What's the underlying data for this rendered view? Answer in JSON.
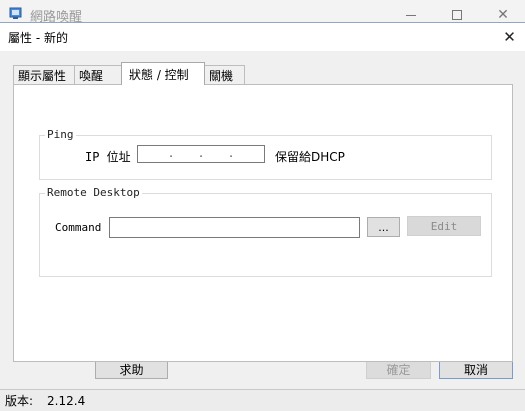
{
  "background_window": {
    "title": "網路喚醒"
  },
  "dialog": {
    "title": "屬性 - 新的",
    "close_glyph": "✕"
  },
  "tabs": [
    {
      "label": "顯示屬性",
      "active": false
    },
    {
      "label": "喚醒",
      "active": false
    },
    {
      "label": "狀態 / 控制",
      "active": true
    },
    {
      "label": "關機",
      "active": false
    }
  ],
  "ping_group": {
    "legend": "Ping",
    "ip_label": "IP 位址",
    "ip_separators": [
      ".",
      ".",
      "."
    ],
    "ip_value": "",
    "dhcp_label": "保留給DHCP"
  },
  "rdp_group": {
    "legend": "Remote Desktop",
    "command_label": "Command",
    "command_value": "",
    "browse_label": "...",
    "edit_label": "Edit"
  },
  "buttons": {
    "help": "求助",
    "ok": "確定",
    "cancel": "取消"
  },
  "statusbar": {
    "version_label": "版本:",
    "version_value": "2.12.4"
  },
  "colors": {
    "dialog_bg": "#f0f0f0",
    "panel_bg": "#ffffff",
    "accent_border": "#7a9cc7"
  }
}
